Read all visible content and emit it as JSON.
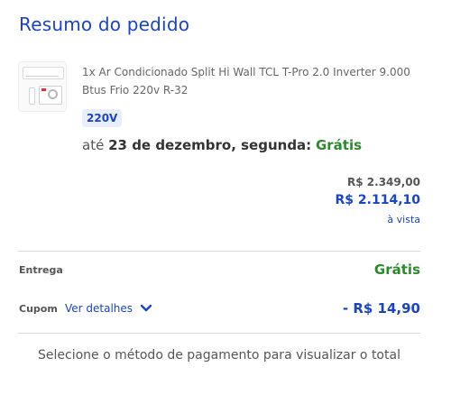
{
  "summary": {
    "title": "Resumo do pedido"
  },
  "item": {
    "name": "1x Ar Condicionado Split Hi Wall TCL T-Pro 2.0 Inverter 9.000 Btus Frio 220v R-32",
    "voltage_badge": "220V",
    "delivery_prefix": "até",
    "delivery_date": "23 de dezembro, segunda:",
    "delivery_cost": "Grátis"
  },
  "pricing": {
    "original_price": "R$ 2.349,00",
    "discounted_price": "R$ 2.114,10",
    "payment_note": "à vista"
  },
  "shipping": {
    "label": "Entrega",
    "value": "Grátis"
  },
  "coupon": {
    "label": "Cupom",
    "link_text": "Ver detalhes",
    "value": "- R$ 14,90"
  },
  "footer": {
    "message": "Selecione o método de pagamento para visualizar o total"
  },
  "colors": {
    "accent": "#1a44c6",
    "success": "#2c8a2c",
    "divider": "#d6d6d6"
  },
  "icons": {
    "coupon_toggle": "chevron-down-icon"
  }
}
